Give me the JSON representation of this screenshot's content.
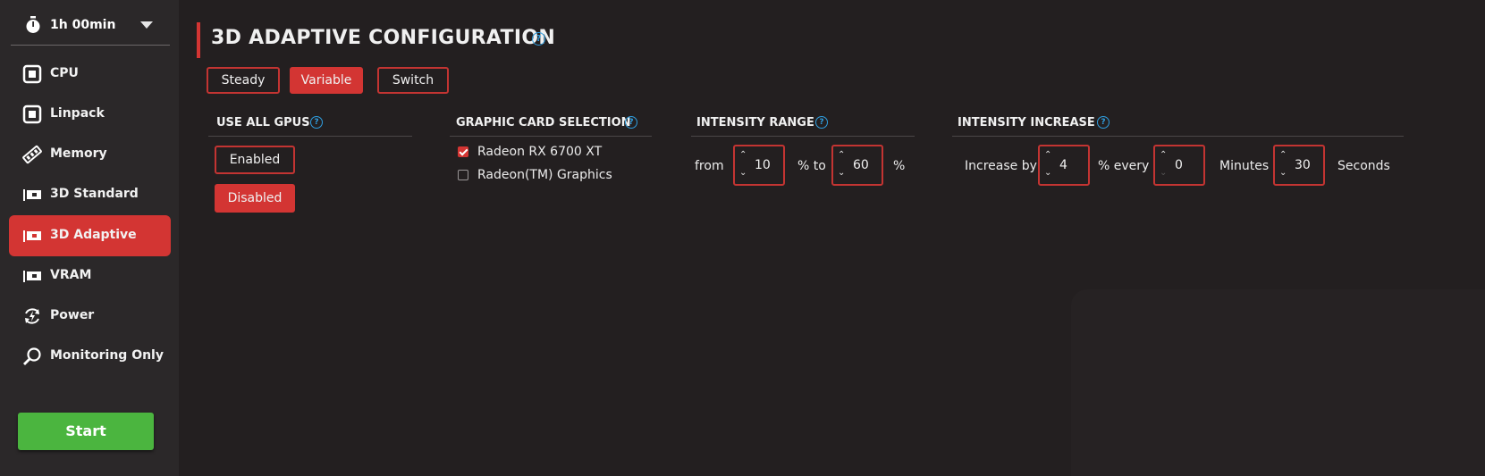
{
  "sidebar": {
    "timer": "1h 00min",
    "items": [
      {
        "label": "CPU",
        "icon": "chip-icon"
      },
      {
        "label": "Linpack",
        "icon": "chip-icon"
      },
      {
        "label": "Memory",
        "icon": "memory-icon"
      },
      {
        "label": "3D Standard",
        "icon": "gpu-icon"
      },
      {
        "label": "3D Adaptive",
        "icon": "gpu-icon",
        "active": true
      },
      {
        "label": "VRAM",
        "icon": "gpu-icon"
      },
      {
        "label": "Power",
        "icon": "power-cycle-icon"
      },
      {
        "label": "Monitoring Only",
        "icon": "magnifier-icon"
      }
    ],
    "start_label": "Start"
  },
  "main": {
    "title": "3D ADAPTIVE CONFIGURATION",
    "modes": [
      "Steady",
      "Variable",
      "Switch"
    ],
    "active_mode": "Variable",
    "use_all_gpus": {
      "heading": "USE ALL GPUS",
      "enabled_label": "Enabled",
      "disabled_label": "Disabled",
      "selected": "Disabled"
    },
    "card_selection": {
      "heading": "GRAPHIC CARD SELECTION",
      "cards": [
        {
          "name": "Radeon RX 6700 XT",
          "checked": true
        },
        {
          "name": "Radeon(TM) Graphics",
          "checked": false
        }
      ]
    },
    "intensity_range": {
      "heading": "INTENSITY RANGE",
      "from_label": "from",
      "from_value": "10",
      "to_label": "% to",
      "to_value": "60",
      "unit": "%"
    },
    "intensity_increase": {
      "heading": "INTENSITY INCREASE",
      "increase_label": "Increase by",
      "increase_value": "4",
      "every_label": "% every",
      "minutes_value": "0",
      "minutes_label": "Minutes",
      "seconds_value": "30",
      "seconds_label": "Seconds"
    }
  },
  "colors": {
    "accent": "#d33533",
    "start": "#4bb53f",
    "help": "#2f9ee0",
    "background": "#231f20",
    "sidebar": "#2b2829"
  }
}
